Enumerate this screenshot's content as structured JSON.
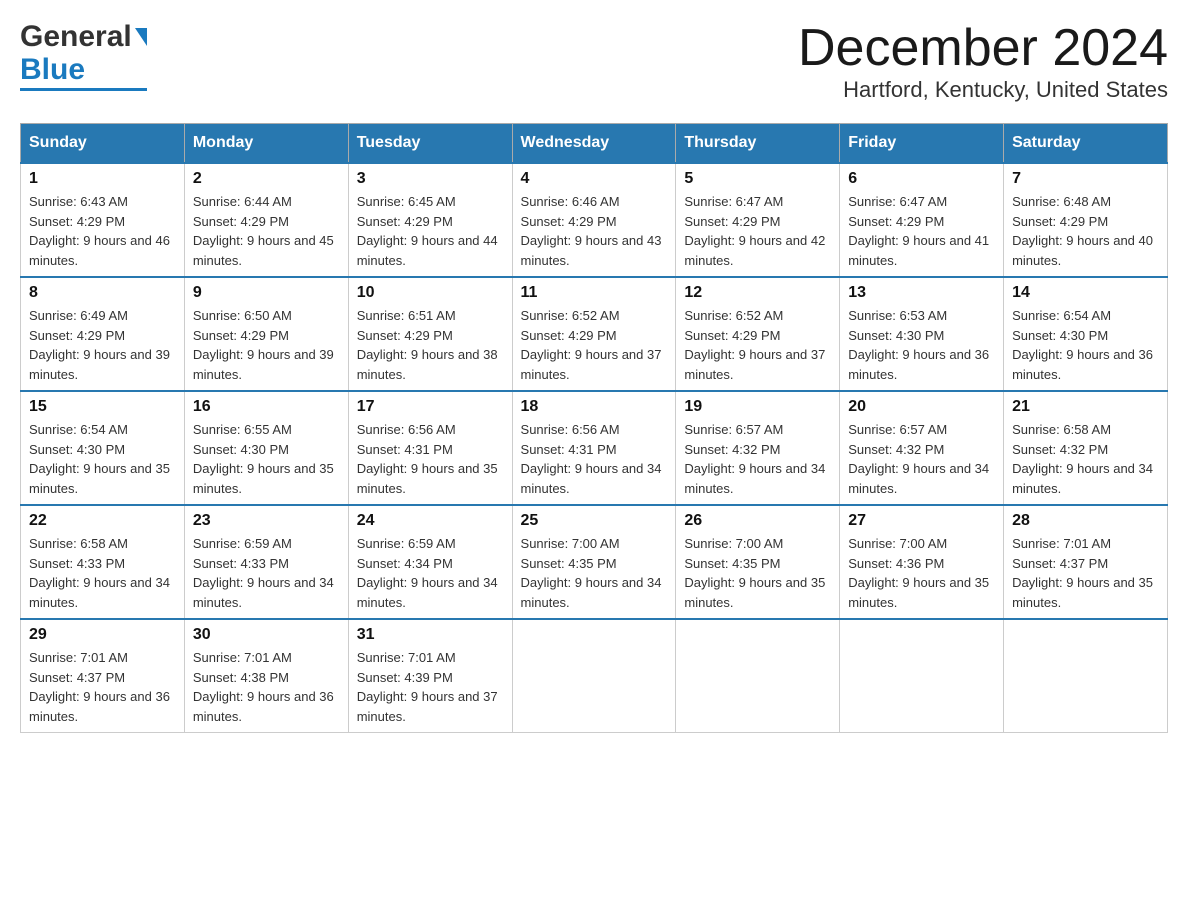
{
  "header": {
    "logo": {
      "general_text": "General",
      "blue_text": "Blue"
    },
    "title": "December 2024",
    "location": "Hartford, Kentucky, United States"
  },
  "calendar": {
    "days_of_week": [
      "Sunday",
      "Monday",
      "Tuesday",
      "Wednesday",
      "Thursday",
      "Friday",
      "Saturday"
    ],
    "weeks": [
      [
        {
          "day": "1",
          "sunrise": "Sunrise: 6:43 AM",
          "sunset": "Sunset: 4:29 PM",
          "daylight": "Daylight: 9 hours and 46 minutes."
        },
        {
          "day": "2",
          "sunrise": "Sunrise: 6:44 AM",
          "sunset": "Sunset: 4:29 PM",
          "daylight": "Daylight: 9 hours and 45 minutes."
        },
        {
          "day": "3",
          "sunrise": "Sunrise: 6:45 AM",
          "sunset": "Sunset: 4:29 PM",
          "daylight": "Daylight: 9 hours and 44 minutes."
        },
        {
          "day": "4",
          "sunrise": "Sunrise: 6:46 AM",
          "sunset": "Sunset: 4:29 PM",
          "daylight": "Daylight: 9 hours and 43 minutes."
        },
        {
          "day": "5",
          "sunrise": "Sunrise: 6:47 AM",
          "sunset": "Sunset: 4:29 PM",
          "daylight": "Daylight: 9 hours and 42 minutes."
        },
        {
          "day": "6",
          "sunrise": "Sunrise: 6:47 AM",
          "sunset": "Sunset: 4:29 PM",
          "daylight": "Daylight: 9 hours and 41 minutes."
        },
        {
          "day": "7",
          "sunrise": "Sunrise: 6:48 AM",
          "sunset": "Sunset: 4:29 PM",
          "daylight": "Daylight: 9 hours and 40 minutes."
        }
      ],
      [
        {
          "day": "8",
          "sunrise": "Sunrise: 6:49 AM",
          "sunset": "Sunset: 4:29 PM",
          "daylight": "Daylight: 9 hours and 39 minutes."
        },
        {
          "day": "9",
          "sunrise": "Sunrise: 6:50 AM",
          "sunset": "Sunset: 4:29 PM",
          "daylight": "Daylight: 9 hours and 39 minutes."
        },
        {
          "day": "10",
          "sunrise": "Sunrise: 6:51 AM",
          "sunset": "Sunset: 4:29 PM",
          "daylight": "Daylight: 9 hours and 38 minutes."
        },
        {
          "day": "11",
          "sunrise": "Sunrise: 6:52 AM",
          "sunset": "Sunset: 4:29 PM",
          "daylight": "Daylight: 9 hours and 37 minutes."
        },
        {
          "day": "12",
          "sunrise": "Sunrise: 6:52 AM",
          "sunset": "Sunset: 4:29 PM",
          "daylight": "Daylight: 9 hours and 37 minutes."
        },
        {
          "day": "13",
          "sunrise": "Sunrise: 6:53 AM",
          "sunset": "Sunset: 4:30 PM",
          "daylight": "Daylight: 9 hours and 36 minutes."
        },
        {
          "day": "14",
          "sunrise": "Sunrise: 6:54 AM",
          "sunset": "Sunset: 4:30 PM",
          "daylight": "Daylight: 9 hours and 36 minutes."
        }
      ],
      [
        {
          "day": "15",
          "sunrise": "Sunrise: 6:54 AM",
          "sunset": "Sunset: 4:30 PM",
          "daylight": "Daylight: 9 hours and 35 minutes."
        },
        {
          "day": "16",
          "sunrise": "Sunrise: 6:55 AM",
          "sunset": "Sunset: 4:30 PM",
          "daylight": "Daylight: 9 hours and 35 minutes."
        },
        {
          "day": "17",
          "sunrise": "Sunrise: 6:56 AM",
          "sunset": "Sunset: 4:31 PM",
          "daylight": "Daylight: 9 hours and 35 minutes."
        },
        {
          "day": "18",
          "sunrise": "Sunrise: 6:56 AM",
          "sunset": "Sunset: 4:31 PM",
          "daylight": "Daylight: 9 hours and 34 minutes."
        },
        {
          "day": "19",
          "sunrise": "Sunrise: 6:57 AM",
          "sunset": "Sunset: 4:32 PM",
          "daylight": "Daylight: 9 hours and 34 minutes."
        },
        {
          "day": "20",
          "sunrise": "Sunrise: 6:57 AM",
          "sunset": "Sunset: 4:32 PM",
          "daylight": "Daylight: 9 hours and 34 minutes."
        },
        {
          "day": "21",
          "sunrise": "Sunrise: 6:58 AM",
          "sunset": "Sunset: 4:32 PM",
          "daylight": "Daylight: 9 hours and 34 minutes."
        }
      ],
      [
        {
          "day": "22",
          "sunrise": "Sunrise: 6:58 AM",
          "sunset": "Sunset: 4:33 PM",
          "daylight": "Daylight: 9 hours and 34 minutes."
        },
        {
          "day": "23",
          "sunrise": "Sunrise: 6:59 AM",
          "sunset": "Sunset: 4:33 PM",
          "daylight": "Daylight: 9 hours and 34 minutes."
        },
        {
          "day": "24",
          "sunrise": "Sunrise: 6:59 AM",
          "sunset": "Sunset: 4:34 PM",
          "daylight": "Daylight: 9 hours and 34 minutes."
        },
        {
          "day": "25",
          "sunrise": "Sunrise: 7:00 AM",
          "sunset": "Sunset: 4:35 PM",
          "daylight": "Daylight: 9 hours and 34 minutes."
        },
        {
          "day": "26",
          "sunrise": "Sunrise: 7:00 AM",
          "sunset": "Sunset: 4:35 PM",
          "daylight": "Daylight: 9 hours and 35 minutes."
        },
        {
          "day": "27",
          "sunrise": "Sunrise: 7:00 AM",
          "sunset": "Sunset: 4:36 PM",
          "daylight": "Daylight: 9 hours and 35 minutes."
        },
        {
          "day": "28",
          "sunrise": "Sunrise: 7:01 AM",
          "sunset": "Sunset: 4:37 PM",
          "daylight": "Daylight: 9 hours and 35 minutes."
        }
      ],
      [
        {
          "day": "29",
          "sunrise": "Sunrise: 7:01 AM",
          "sunset": "Sunset: 4:37 PM",
          "daylight": "Daylight: 9 hours and 36 minutes."
        },
        {
          "day": "30",
          "sunrise": "Sunrise: 7:01 AM",
          "sunset": "Sunset: 4:38 PM",
          "daylight": "Daylight: 9 hours and 36 minutes."
        },
        {
          "day": "31",
          "sunrise": "Sunrise: 7:01 AM",
          "sunset": "Sunset: 4:39 PM",
          "daylight": "Daylight: 9 hours and 37 minutes."
        },
        null,
        null,
        null,
        null
      ]
    ]
  }
}
